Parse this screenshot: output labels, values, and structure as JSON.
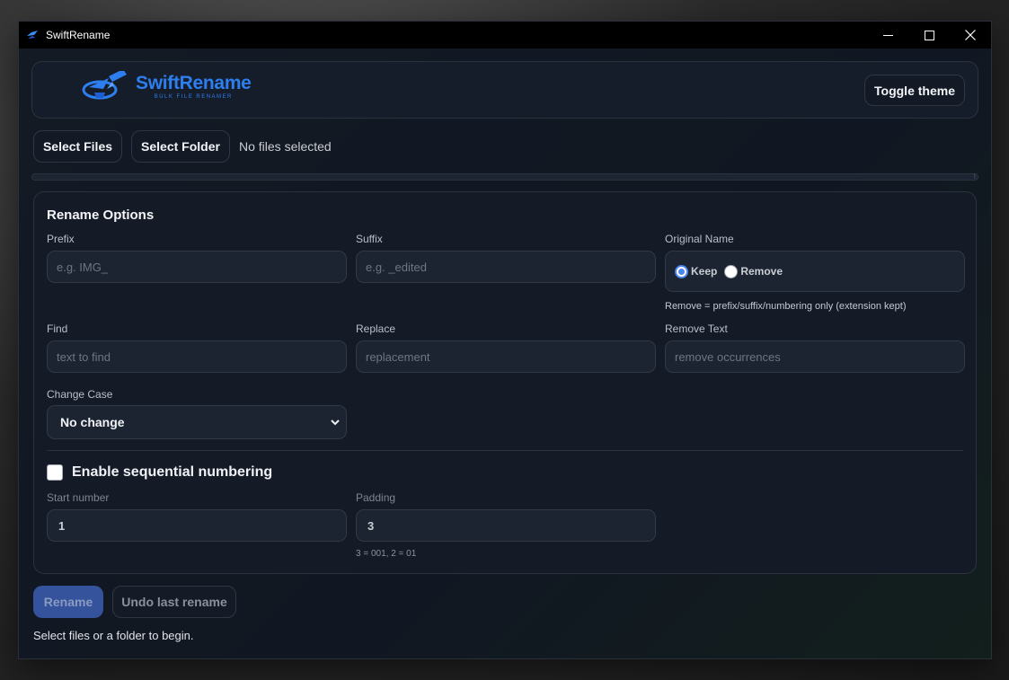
{
  "window": {
    "title": "SwiftRename",
    "controls": {
      "minimize": "minimize-icon",
      "maximize": "maximize-icon",
      "close": "close-icon"
    }
  },
  "header": {
    "logo_title": "SwiftRename",
    "logo_subtitle": "BULK FILE RENAMER",
    "toggle_theme_label": "Toggle theme"
  },
  "files": {
    "select_files_label": "Select Files",
    "select_folder_label": "Select Folder",
    "status": "No files selected",
    "progress": 0
  },
  "options": {
    "title": "Rename Options",
    "prefix": {
      "label": "Prefix",
      "placeholder": "e.g. IMG_"
    },
    "suffix": {
      "label": "Suffix",
      "placeholder": "e.g. _edited"
    },
    "original_name": {
      "label": "Original Name",
      "keep_label": "Keep",
      "remove_label": "Remove",
      "selected": "Keep",
      "hint": "Remove = prefix/suffix/numbering only (extension kept)"
    },
    "find": {
      "label": "Find",
      "placeholder": "text to find"
    },
    "replace": {
      "label": "Replace",
      "placeholder": "replacement"
    },
    "remove_text": {
      "label": "Remove Text",
      "placeholder": "remove occurrences"
    },
    "change_case": {
      "label": "Change Case",
      "selected": "No change"
    },
    "numbering": {
      "enable_label": "Enable sequential numbering",
      "enabled": false,
      "start_label": "Start number",
      "start_value": "1",
      "padding_label": "Padding",
      "padding_value": "3",
      "padding_hint": "3 = 001, 2 = 01"
    }
  },
  "actions": {
    "rename_label": "Rename",
    "undo_label": "Undo last rename"
  },
  "status_message": "Select files or a folder to begin.",
  "colors": {
    "accent": "#2d7ff0",
    "background": "#141a24",
    "rename_disabled": "#34539c"
  }
}
